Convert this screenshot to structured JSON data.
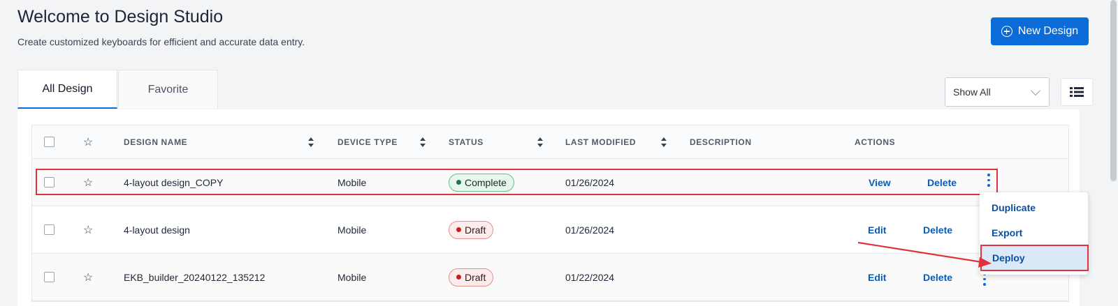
{
  "header": {
    "title": "Welcome to Design Studio",
    "subtitle": "Create customized keyboards for efficient and accurate data entry.",
    "new_design_label": "New Design"
  },
  "tabs": [
    {
      "label": "All Design",
      "active": true
    },
    {
      "label": "Favorite",
      "active": false
    }
  ],
  "filter": {
    "selected": "Show All"
  },
  "icons": {
    "new_design": "plus-circle-icon",
    "filter": "chevron-down-icon",
    "view_toggle": "list-view-icon",
    "favorite": "star-outline-icon",
    "more": "kebab-menu-icon"
  },
  "table": {
    "columns": [
      "DESIGN NAME",
      "DEVICE TYPE",
      "STATUS",
      "LAST MODIFIED",
      "DESCRIPTION",
      "ACTIONS"
    ],
    "rows": [
      {
        "name": "4-layout design_COPY",
        "device": "Mobile",
        "status": "Complete",
        "modified": "01/26/2024",
        "description": "",
        "action1": "View",
        "action2": "Delete"
      },
      {
        "name": "4-layout design",
        "device": "Mobile",
        "status": "Draft",
        "modified": "01/26/2024",
        "description": "",
        "action1": "Edit",
        "action2": "Delete"
      },
      {
        "name": "EKB_builder_20240122_135212",
        "device": "Mobile",
        "status": "Draft",
        "modified": "01/22/2024",
        "description": "",
        "action1": "Edit",
        "action2": "Delete"
      }
    ]
  },
  "row_menu": {
    "items": [
      "Duplicate",
      "Export",
      "Deploy"
    ],
    "highlighted": "Deploy"
  },
  "colors": {
    "primary": "#0b6cd9",
    "link": "#0b5bb5",
    "annotation": "#e0323c",
    "complete_bg": "#e8f7ee",
    "draft_bg": "#fdeceb"
  }
}
